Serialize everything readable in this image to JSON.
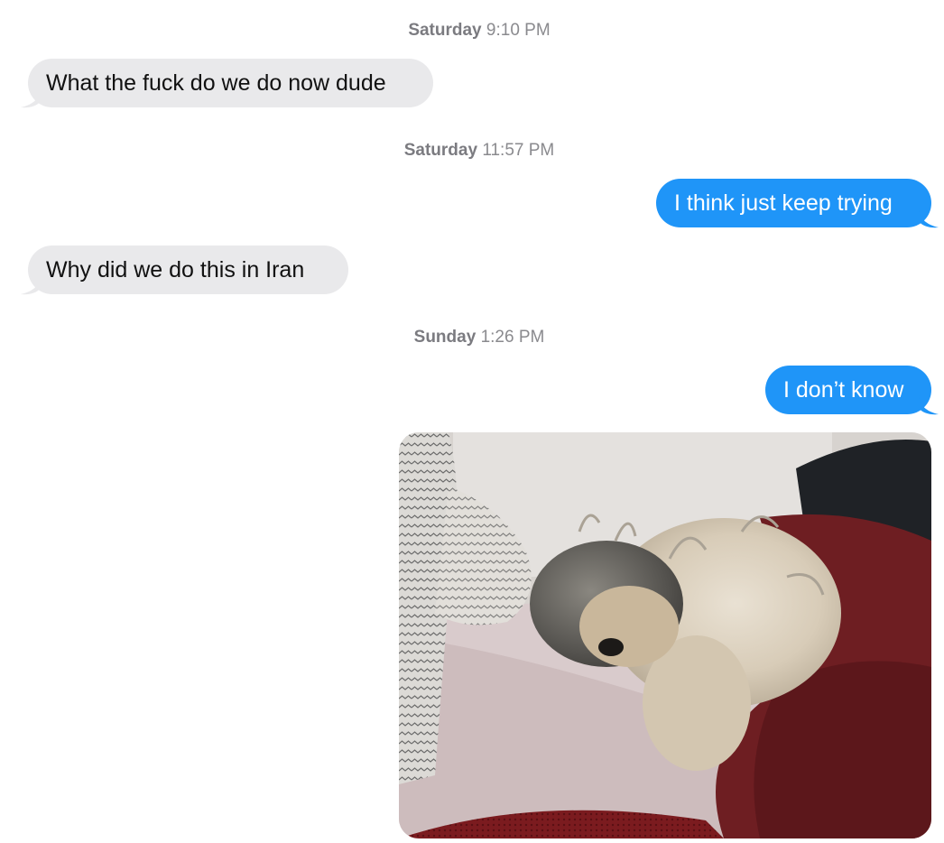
{
  "conversation": {
    "groups": [
      {
        "day": "Saturday",
        "time": "9:10 PM"
      },
      {
        "day": "Saturday",
        "time": "11:57 PM"
      },
      {
        "day": "Sunday",
        "time": "1:26 PM"
      }
    ],
    "messages": [
      {
        "direction": "incoming",
        "text": "What the fuck do we do now dude"
      },
      {
        "direction": "outgoing",
        "text": "I think just keep trying"
      },
      {
        "direction": "incoming",
        "text": "Why did we do this in Iran"
      },
      {
        "direction": "outgoing",
        "text": "I don’t know"
      }
    ],
    "attachment": {
      "kind": "photo",
      "subject": "sleeping-dog"
    }
  },
  "colors": {
    "incoming_bubble": "#e9e9eb",
    "outgoing_bubble": "#1f95f8",
    "timestamp_text": "#8a8a8e"
  }
}
